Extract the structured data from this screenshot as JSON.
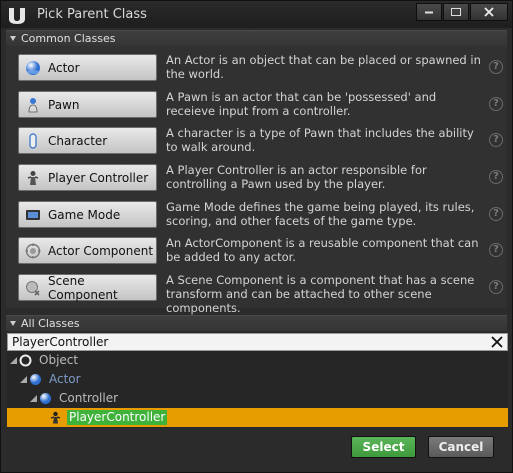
{
  "window": {
    "title": "Pick Parent Class"
  },
  "common_classes": {
    "header": "Common Classes",
    "items": [
      {
        "label": "Actor",
        "icon": "sphere-icon",
        "description": "An Actor is an object that can be placed or spawned in the world."
      },
      {
        "label": "Pawn",
        "icon": "pawn-icon",
        "description": "A Pawn is an actor that can be 'possessed' and receieve input from a controller."
      },
      {
        "label": "Character",
        "icon": "character-icon",
        "description": "A character is a type of Pawn that includes the ability to walk around."
      },
      {
        "label": "Player Controller",
        "icon": "player-controller-icon",
        "description": "A Player Controller is an actor responsible for controlling a Pawn used by the player."
      },
      {
        "label": "Game Mode",
        "icon": "game-mode-icon",
        "description": "Game Mode defines the game being played, its rules, scoring, and other facets of the game type."
      },
      {
        "label": "Actor Component",
        "icon": "actor-component-icon",
        "description": "An ActorComponent is a reusable component that can be added to any actor."
      },
      {
        "label": "Scene Component",
        "icon": "scene-component-icon",
        "description": "A Scene Component is a component that has a scene transform and can be attached to other scene components."
      }
    ]
  },
  "all_classes": {
    "header": "All Classes",
    "search_value": "PlayerController",
    "tree": [
      {
        "label": "Object",
        "depth": 0
      },
      {
        "label": "Actor",
        "depth": 1
      },
      {
        "label": "Controller",
        "depth": 2
      },
      {
        "label": "PlayerController",
        "depth": 3,
        "selected": true
      }
    ]
  },
  "buttons": {
    "select": "Select",
    "cancel": "Cancel"
  },
  "colors": {
    "accent_select": "#4caf4a",
    "tree_selected": "#e79d00",
    "tree_label_highlight": "#3fb23a"
  }
}
